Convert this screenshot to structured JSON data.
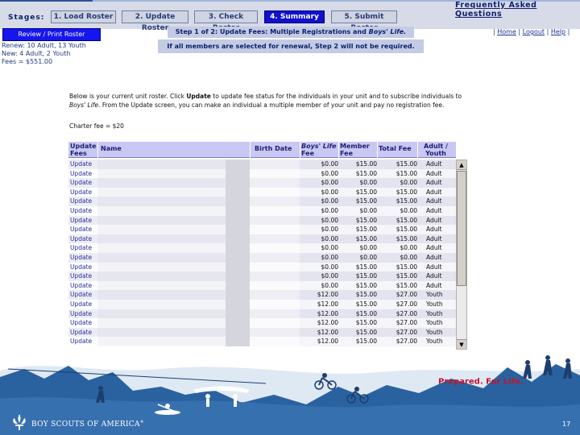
{
  "nav": {
    "stages_label": "Stages:",
    "stages": [
      {
        "label": "1. Load Roster",
        "active": false
      },
      {
        "label": "2. Update Roster",
        "active": false
      },
      {
        "label": "3. Check Roster",
        "active": false
      },
      {
        "label": "4. Summary",
        "active": true
      },
      {
        "label": "5. Submit Roster",
        "active": false
      }
    ],
    "faq": "Frequently Asked Questions"
  },
  "sidebar": {
    "review_button": "Review / Print Roster",
    "renew": "Renew: 10 Adult, 13 Youth",
    "new": "New: 4 Adult, 2 Youth",
    "fees": "Fees = $551.00"
  },
  "banner": {
    "step_prefix": "Step 1 of 2: Update Fees: Multiple Registrations and ",
    "step_italic": "Boys' Life.",
    "note": "If all members are selected for renewal, Step 2 will not be required."
  },
  "toplinks": {
    "home": "Home",
    "logout": "Logout",
    "help": "Help"
  },
  "instructions": {
    "p1": "Below is your current unit roster. Click ",
    "p1_bold": "Update",
    "p2": " to update fee status for the individuals in your unit and to subscribe individuals to ",
    "p2_italic": "Boys' Life",
    "p3": ". From the Update screen, you can make an individual a multiple member of your unit and pay no registration fee.",
    "charter": "Charter fee = $20"
  },
  "table": {
    "headers": {
      "update": "Update Fees",
      "name": "Name",
      "birth": "Birth Date",
      "boys_italic": "Boys' Life",
      "boys_rest": "Fee",
      "member": "Member Fee",
      "total": "Total Fee",
      "age": "Adult / Youth"
    },
    "rows": [
      {
        "update": "Update",
        "boys": "$0.00",
        "member": "$15.00",
        "total": "$15.00",
        "age": "Adult"
      },
      {
        "update": "Update",
        "boys": "$0.00",
        "member": "$15.00",
        "total": "$15.00",
        "age": "Adult"
      },
      {
        "update": "Update",
        "boys": "$0.00",
        "member": "$0.00",
        "total": "$0.00",
        "age": "Adult"
      },
      {
        "update": "Update",
        "boys": "$0.00",
        "member": "$15.00",
        "total": "$15.00",
        "age": "Adult"
      },
      {
        "update": "Update",
        "boys": "$0.00",
        "member": "$15.00",
        "total": "$15.00",
        "age": "Adult"
      },
      {
        "update": "Update",
        "boys": "$0.00",
        "member": "$0.00",
        "total": "$0.00",
        "age": "Adult"
      },
      {
        "update": "Update",
        "boys": "$0.00",
        "member": "$15.00",
        "total": "$15.00",
        "age": "Adult"
      },
      {
        "update": "Update",
        "boys": "$0.00",
        "member": "$15.00",
        "total": "$15.00",
        "age": "Adult"
      },
      {
        "update": "Update",
        "boys": "$0.00",
        "member": "$15.00",
        "total": "$15.00",
        "age": "Adult"
      },
      {
        "update": "Update",
        "boys": "$0.00",
        "member": "$0.00",
        "total": "$0.00",
        "age": "Adult"
      },
      {
        "update": "Update",
        "boys": "$0.00",
        "member": "$0.00",
        "total": "$0.00",
        "age": "Adult"
      },
      {
        "update": "Update",
        "boys": "$0.00",
        "member": "$15.00",
        "total": "$15.00",
        "age": "Adult"
      },
      {
        "update": "Update",
        "boys": "$0.00",
        "member": "$15.00",
        "total": "$15.00",
        "age": "Adult"
      },
      {
        "update": "Update",
        "boys": "$0.00",
        "member": "$15.00",
        "total": "$15.00",
        "age": "Adult"
      },
      {
        "update": "Update",
        "boys": "$12.00",
        "member": "$15.00",
        "total": "$27.00",
        "age": "Youth"
      },
      {
        "update": "Update",
        "boys": "$12.00",
        "member": "$15.00",
        "total": "$27.00",
        "age": "Youth"
      },
      {
        "update": "Update",
        "boys": "$12.00",
        "member": "$15.00",
        "total": "$27.00",
        "age": "Youth"
      },
      {
        "update": "Update",
        "boys": "$12.00",
        "member": "$15.00",
        "total": "$27.00",
        "age": "Youth"
      },
      {
        "update": "Update",
        "boys": "$12.00",
        "member": "$15.00",
        "total": "$27.00",
        "age": "Youth"
      },
      {
        "update": "Update",
        "boys": "$12.00",
        "member": "$15.00",
        "total": "$27.00",
        "age": "Youth"
      }
    ]
  },
  "footer": {
    "tagline": "Prepared. For Life.",
    "tagline_tm": "™",
    "org": "BOY SCOUTS OF AMERICA",
    "org_mark": "®",
    "page_number": "17",
    "logo_icon": "fleur-de-lis-icon"
  },
  "colors": {
    "accent_blue": "#1515ee",
    "header_purple": "#c9c7f3",
    "banner_blue": "#2a62a0",
    "tagline_red": "#c0162c"
  }
}
